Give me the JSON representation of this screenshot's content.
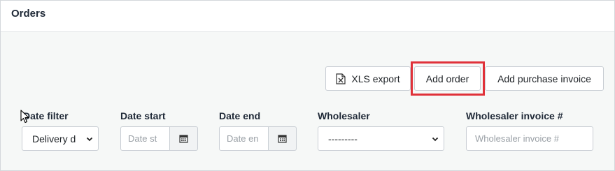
{
  "header": {
    "title": "Orders"
  },
  "toolbar": {
    "xls_export_label": "XLS export",
    "add_order_label": "Add order",
    "add_purchase_invoice_label": "Add purchase invoice"
  },
  "filters": {
    "date_filter": {
      "label": "Date filter",
      "value": "Delivery d"
    },
    "date_start": {
      "label": "Date start",
      "placeholder": "Date st"
    },
    "date_end": {
      "label": "Date end",
      "placeholder": "Date en"
    },
    "wholesaler": {
      "label": "Wholesaler",
      "value": "---------"
    },
    "wholesaler_invoice": {
      "label": "Wholesaler invoice #",
      "placeholder": "Wholesaler invoice #"
    }
  },
  "icons": {
    "xls": "file-excel-icon",
    "calendar": "calendar-icon",
    "chevron": "chevron-down-icon",
    "cursor": "mouse-pointer-icon"
  },
  "colors": {
    "highlight": "#e0323a",
    "background": "#f6f8f7"
  }
}
